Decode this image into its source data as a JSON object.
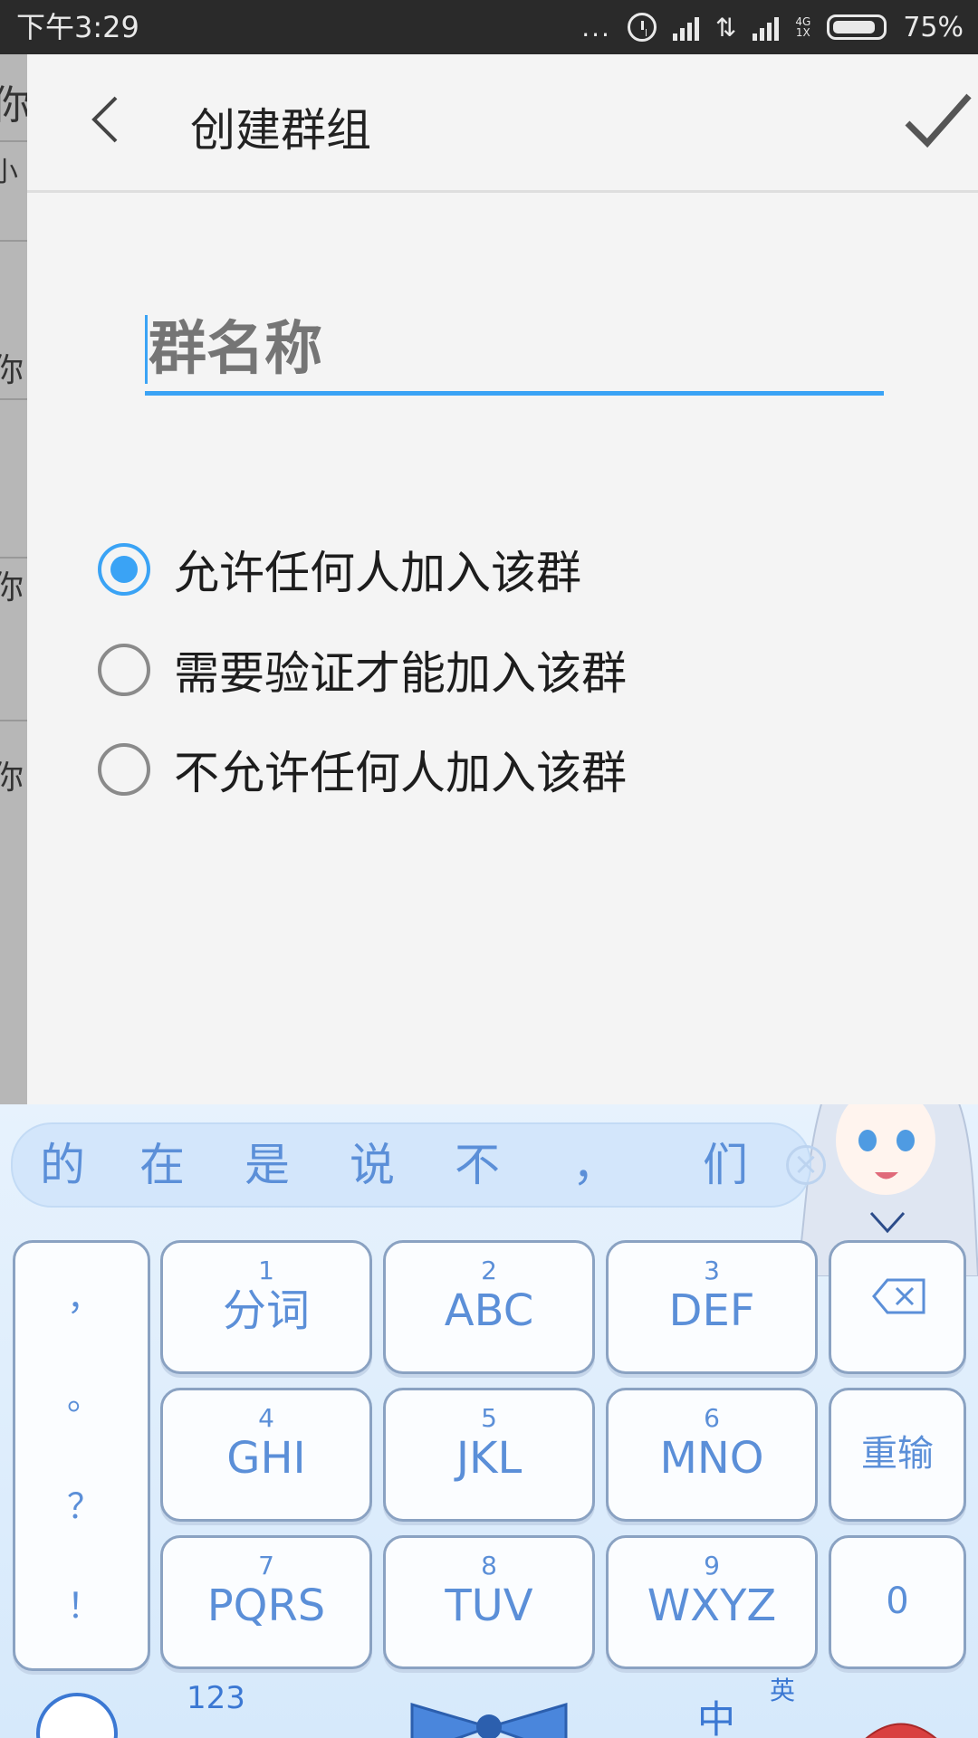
{
  "status_bar": {
    "time": "下午3:29",
    "dots": "...",
    "network_top": "4G",
    "network_bottom": "1X",
    "battery": "75%"
  },
  "background_screen": {
    "chars": [
      "你",
      "小",
      "你",
      "你",
      "你"
    ]
  },
  "header": {
    "title": "创建群组",
    "back_icon": "back-chevron-icon",
    "confirm_icon": "checkmark-icon"
  },
  "group_name": {
    "placeholder": "群名称",
    "value": ""
  },
  "join_options": {
    "selected_index": 0,
    "items": [
      {
        "label": "允许任何人加入该群"
      },
      {
        "label": "需要验证才能加入该群"
      },
      {
        "label": "不允许任何人加入该群"
      }
    ]
  },
  "keyboard": {
    "candidates": [
      "的",
      "在",
      "是",
      "说",
      "不",
      "，",
      "们"
    ],
    "punctuation": [
      "，",
      "。",
      "？",
      "！"
    ],
    "keys": [
      {
        "num": "1",
        "label": "分词"
      },
      {
        "num": "2",
        "label": "ABC"
      },
      {
        "num": "3",
        "label": "DEF"
      },
      {
        "num": "4",
        "label": "GHI"
      },
      {
        "num": "5",
        "label": "JKL"
      },
      {
        "num": "6",
        "label": "MNO"
      },
      {
        "num": "7",
        "label": "PQRS"
      },
      {
        "num": "8",
        "label": "TUV"
      },
      {
        "num": "9",
        "label": "WXYZ"
      }
    ],
    "side_keys": {
      "delete_icon": "backspace-icon",
      "reset": "重输",
      "zero": "0"
    },
    "bottom": {
      "numbers": "123",
      "lang_zh": "中",
      "lang_en": "英"
    },
    "colors": {
      "key_text": "#5b8fd8",
      "accent": "#3aa3f5"
    }
  }
}
